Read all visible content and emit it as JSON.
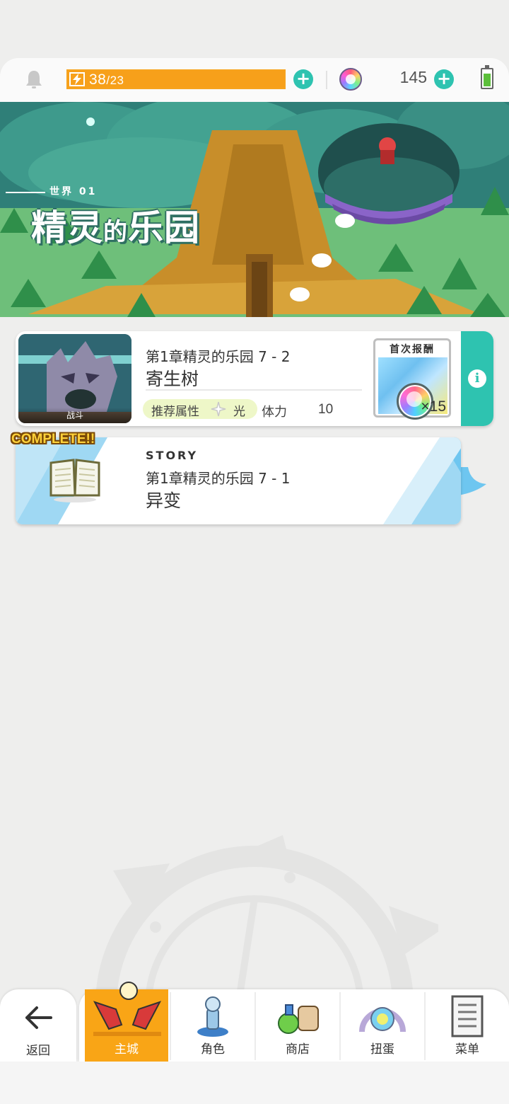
{
  "header": {
    "stamina_current": "38",
    "stamina_max": "23",
    "stamina_separator": "/",
    "stamina_fill_fraction": 1.0,
    "gem_count": "145",
    "add_symbol": "+"
  },
  "banner": {
    "world_label": "世界 01",
    "world_title_part1": "精灵",
    "world_title_part2": "的",
    "world_title_part3": "乐园"
  },
  "quest": {
    "thumb_label": "战斗",
    "chapter": "第1章精灵的乐园 7 - 2",
    "title": "寄生树",
    "attr_label": "推荐属性",
    "attr_value": "光",
    "stamina_label": "体力",
    "stamina_cost": "10",
    "reward_title": "首次报酬",
    "reward_count": "×15",
    "info_symbol": "i"
  },
  "story": {
    "complete_badge": "COMPLETE!!",
    "tag": "STORY",
    "chapter": "第1章精灵的乐园 7 - 1",
    "title": "异变"
  },
  "nav": {
    "back": "返回",
    "home": "主城",
    "characters": "角色",
    "shop": "商店",
    "gacha": "扭蛋",
    "menu": "菜单"
  },
  "colors": {
    "accent_teal": "#2ec3b0",
    "stamina_orange": "#f7a01a",
    "active_tab_orange": "#f9a516",
    "story_blue": "#6ec6f0"
  },
  "icons": [
    "bell-icon",
    "bolt-icon",
    "plus-icon",
    "rainbow-gem-icon",
    "battery-icon",
    "sparkle-icon",
    "info-icon",
    "book-icon",
    "back-arrow-icon",
    "home-city-icon",
    "character-icon",
    "shop-icon",
    "gacha-icon",
    "menu-list-icon"
  ]
}
